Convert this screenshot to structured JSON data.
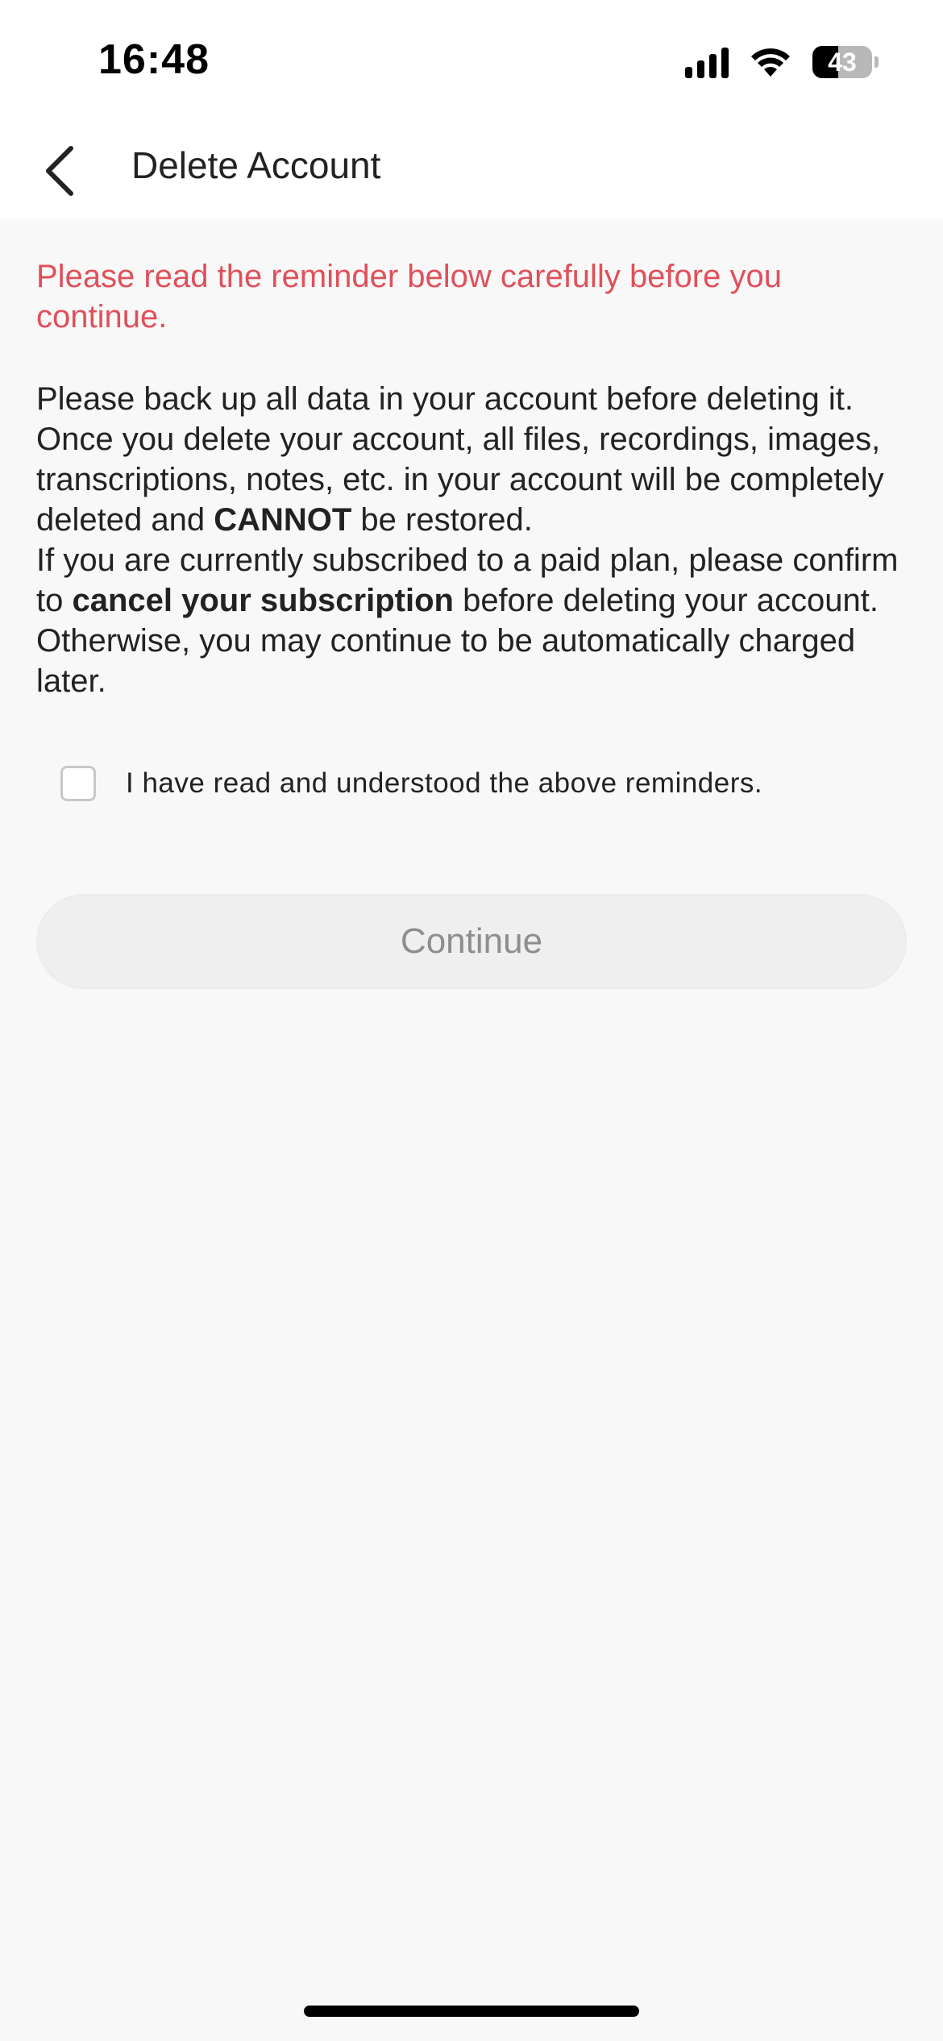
{
  "status_bar": {
    "time": "16:48",
    "battery_level": "43",
    "battery_fraction": 0.43,
    "icons": [
      "signal-icon",
      "wifi-icon",
      "battery-icon"
    ]
  },
  "nav": {
    "back_icon": "chevron-left-icon",
    "title": "Delete Account"
  },
  "warning": "Please read the reminder below carefully before you continue.",
  "body": {
    "p1_a": "Please back up all data in your account before deleting it. Once you delete your account, all files, recordings, images, transcriptions, notes, etc. in your account will be completely deleted and ",
    "p1_bold": "CANNOT",
    "p1_b": " be restored.",
    "p2_a": "If you are currently subscribed to a paid plan, please confirm to ",
    "p2_bold": "cancel your subscription",
    "p2_b": " before deleting your account. Otherwise, you may continue to be automatically charged later."
  },
  "confirm": {
    "label": "I have read and understood the above reminders.",
    "checked": false
  },
  "continue_label": "Continue",
  "colors": {
    "warning": "#e0505a",
    "button_bg": "#efefef",
    "button_text": "#8e8e8e"
  }
}
